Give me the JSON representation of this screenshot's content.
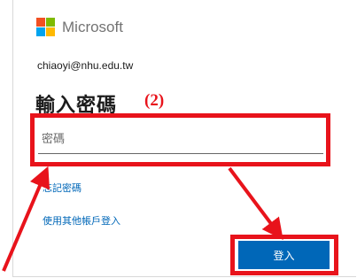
{
  "header": {
    "brand_text": "Microsoft",
    "logo_colors": [
      "#f25022",
      "#7fba00",
      "#00a4ef",
      "#ffb900"
    ]
  },
  "account": {
    "email": "chiaoyi@nhu.edu.tw"
  },
  "page": {
    "title": "輸入密碼"
  },
  "annotation": {
    "step_label": "(2)",
    "color": "#e8131b"
  },
  "password_field": {
    "placeholder": "密碼",
    "value": ""
  },
  "links": {
    "forgot_password": "忘記密碼",
    "other_sign_in": "使用其他帳戶登入"
  },
  "buttons": {
    "sign_in": "登入"
  },
  "colors": {
    "accent": "#0067b8",
    "annotation_red": "#e8131b"
  }
}
